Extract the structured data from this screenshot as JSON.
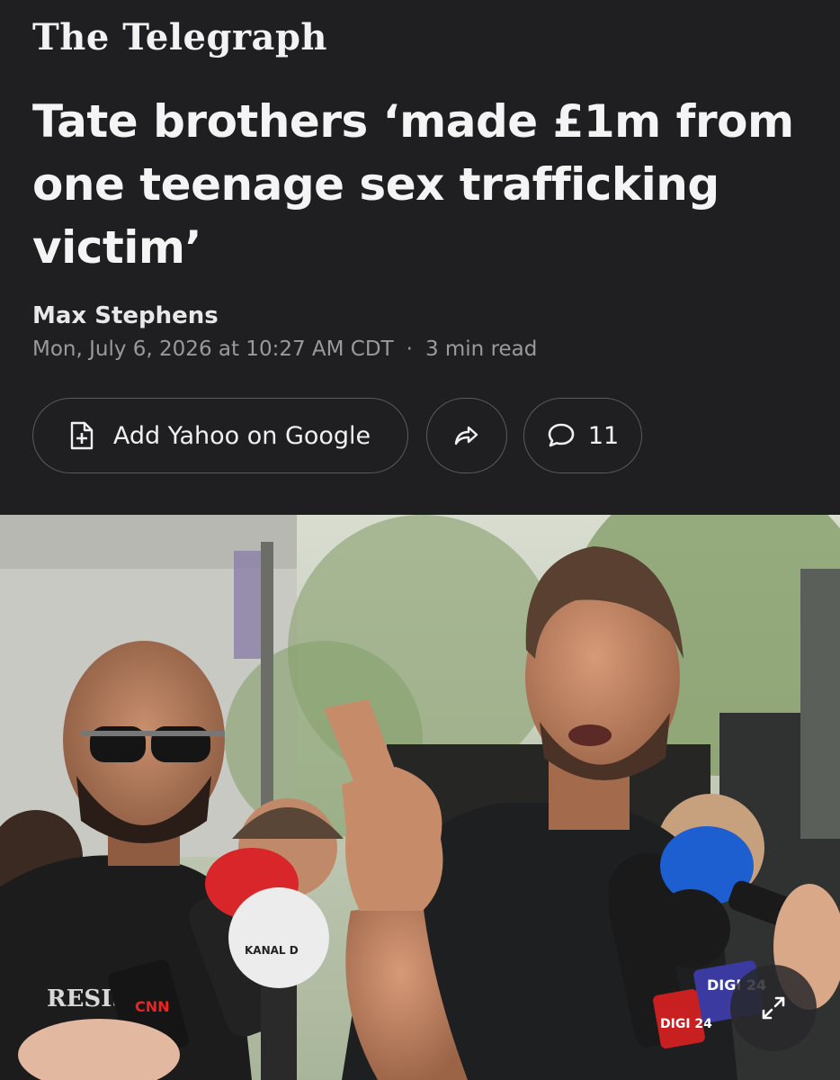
{
  "masthead": {
    "name": "The Telegraph"
  },
  "article": {
    "headline": "Tate brothers ‘made £1m from one teenage sex trafficking victim’",
    "author": "Max Stephens",
    "published": "Mon, July 6, 2026 at 10:27 AM CDT",
    "separator": "·",
    "read_time": "3 min read"
  },
  "actions": {
    "add_google_label": "Add Yahoo on Google",
    "share_icon": "share-arrow-icon",
    "comments_icon": "speech-bubble-icon",
    "comment_count": "11"
  },
  "photo": {
    "expand_icon": "expand-arrows-icon",
    "shirt_text": "RESIST",
    "mic_labels": [
      "KANAL D",
      "DIGI 24",
      "DIGI 24",
      "CNN"
    ]
  },
  "colors": {
    "background": "#1f1f21",
    "text_primary": "#f4f4f4",
    "text_secondary": "#9a9a9e",
    "pill_border": "#5a5a5e"
  }
}
